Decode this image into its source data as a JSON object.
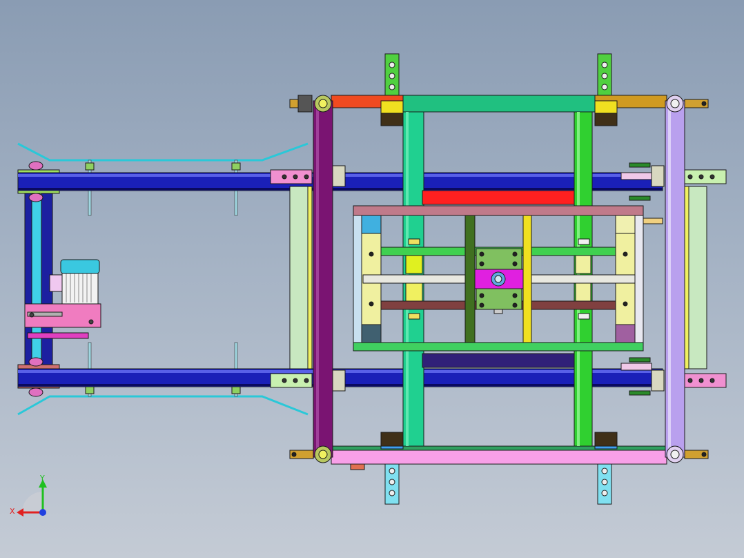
{
  "triad": {
    "x_label": "X",
    "y_label": "Y",
    "x_color": "#e02020",
    "y_color": "#20c020",
    "z_color": "#2040e0"
  },
  "palette": {
    "frame_left": "#7a1472",
    "frame_right": "#b9a0ee",
    "rail": "#1a20b8",
    "motor": "#40c8e0",
    "cross_green": "#22c070",
    "cross_lime": "#30d030",
    "tray_yellow": "#f0f0a0",
    "bracket_pink": "#f090d0",
    "top_red": "#ff2020",
    "bottom_navy": "#302078",
    "center_magenta": "#e020e0"
  }
}
